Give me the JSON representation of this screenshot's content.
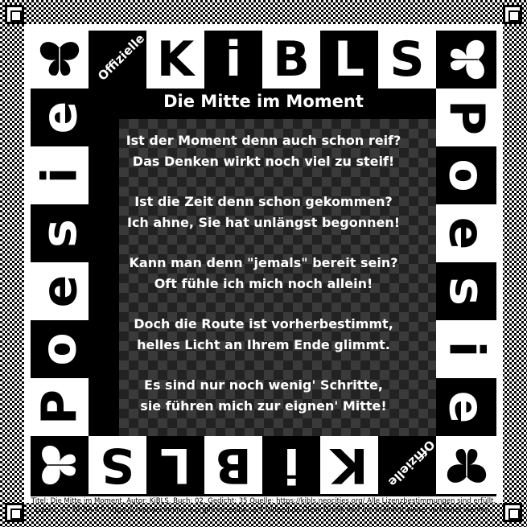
{
  "top_row": [
    "Offizielle",
    "K",
    "i",
    "B",
    "L",
    "S"
  ],
  "bottom_row": [
    "S",
    "L",
    "B",
    "i",
    "K",
    "Offizielle"
  ],
  "left_column": [
    "e",
    "i",
    "s",
    "e",
    "o",
    "P"
  ],
  "right_column": [
    "P",
    "o",
    "e",
    "s",
    "i",
    "e"
  ],
  "icons": {
    "corner": "butterfly-icon"
  },
  "poem": {
    "title": "Die Mitte im Moment",
    "stanzas": [
      [
        "Ist der Moment denn auch schon reif?",
        "Das Denken wirkt noch viel zu steif!"
      ],
      [
        "Ist die Zeit denn schon gekommen?",
        "Ich ahne, Sie hat unlängst begonnen!"
      ],
      [
        "Kann man denn \"jemals\" bereit sein?",
        "Oft fühle ich mich noch allein!"
      ],
      [
        "Doch die Route ist vorherbestimmt,",
        "helles Licht an Ihrem Ende glimmt."
      ],
      [
        "Es sind nur noch wenig' Schritte,",
        "sie führen mich zur eignen' Mitte!"
      ]
    ]
  },
  "footer": {
    "line1": "Titel: Die Mitte im Moment, Autor: KiBLS, Buch: 02, Gedicht: 35 Quelle: https://kibls.neocities.org/ Alle Lizenzbestimmungen sind erfüllt.",
    "line2": "Lizenz: CC BY-SA 4.0 https://creativecommons.org/licenses/by-sa/4.0/deed.de Diese Grafik darf unverändert weiterverbreitet werden."
  }
}
